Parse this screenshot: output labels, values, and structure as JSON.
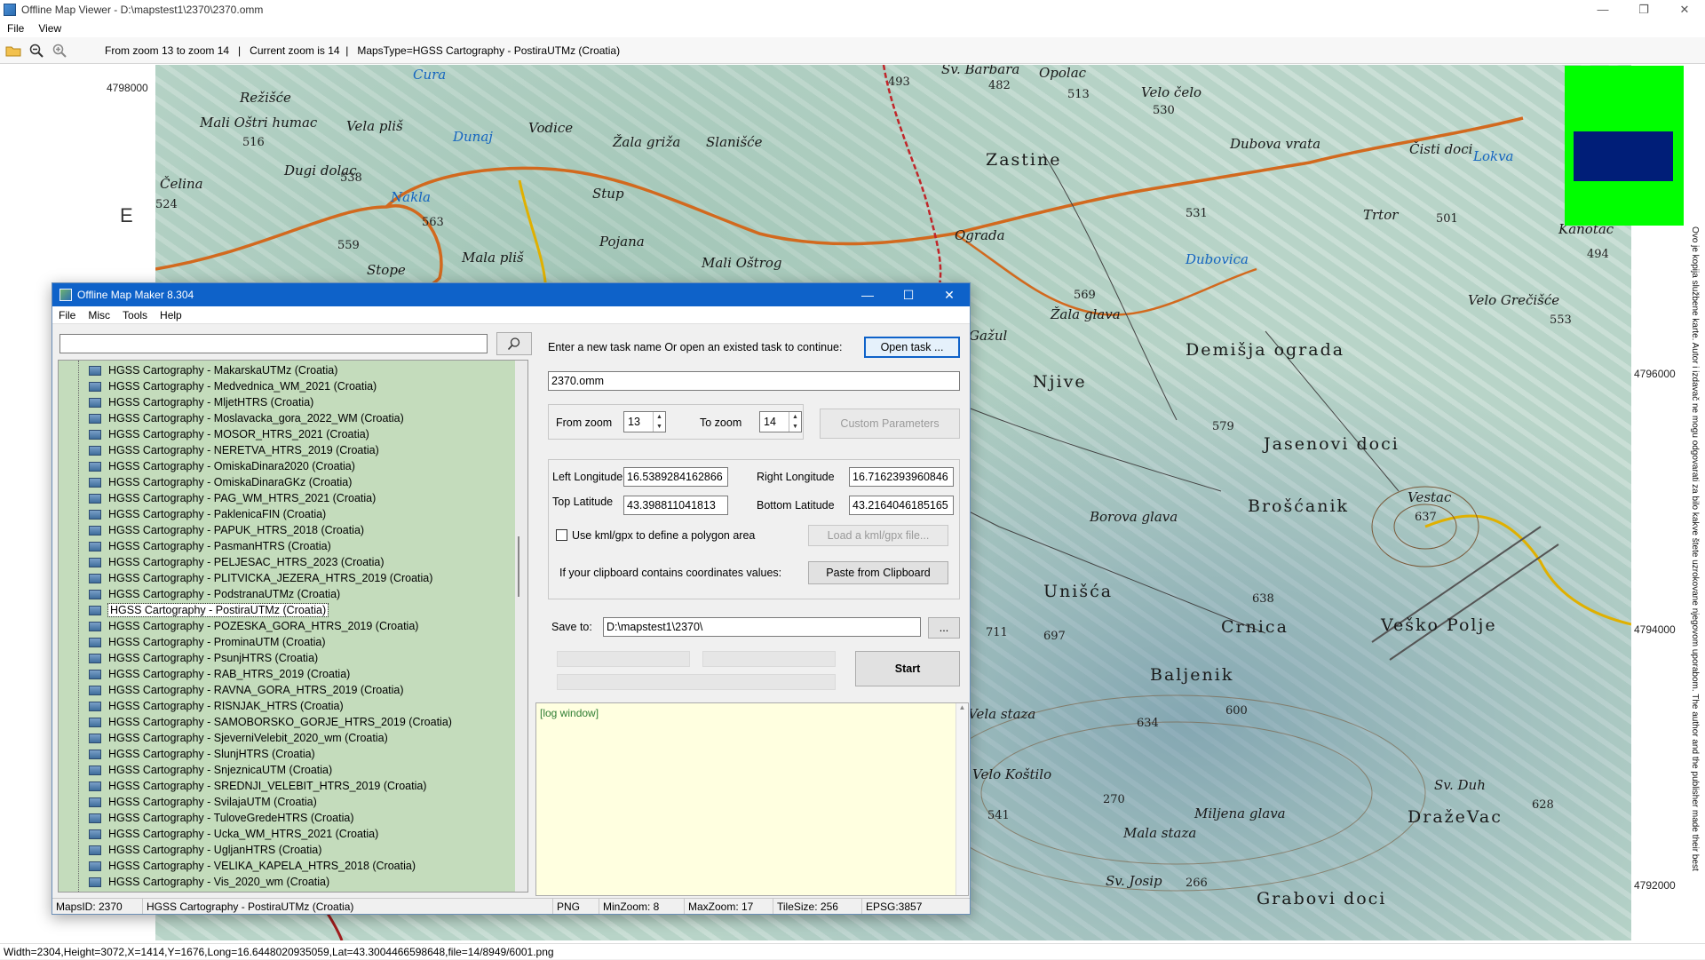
{
  "viewer": {
    "title": "Offline Map Viewer - D:\\mapstest1\\2370\\2370.omm",
    "menu": [
      "File",
      "View"
    ],
    "toolbar_status": "From zoom 13 to zoom 14   |   Current zoom is 14  |   MapsType=HGSS Cartography - PostiraUTMz (Croatia)",
    "status_bar": "Width=2304,Height=3072,X=1414,Y=1676,Long=16.6448020935059,Lat=43.3004466598648,file=14/8949/6001.png"
  },
  "map": {
    "coords_left": [
      "4798000"
    ],
    "coords_right": [
      "4796000",
      "4794000",
      "4792000"
    ],
    "edge_letter": "E",
    "labels": [
      "Režišće",
      "Mali Oštri humac",
      "Cura",
      "Dunaj",
      "Vodice",
      "Žala griža",
      "Slanišće",
      "Stup",
      "Pojana",
      "Mali Oštrog",
      "Nakla",
      "Čelina",
      "Ograda",
      "Zastine",
      "Opolac",
      "Velo čelo",
      "Dubova vrata",
      "Čisti doci",
      "Lokva",
      "Trtor",
      "Kanotac",
      "Dubovica",
      "Demišja ograda",
      "Velo Grečišće",
      "Žala glava",
      "Njive",
      "Jasenovi doci",
      "Brošćanik",
      "Vestac",
      "Borova glava",
      "Unišća",
      "Crnica",
      "Baljenik",
      "Veško Polje",
      "Mala staza",
      "Miljena glava",
      "Sv. Josip",
      "Sv. Duh",
      "DražeVac",
      "Grabovi doci",
      "Sv. Barbara",
      "Mala pliš",
      "Stope",
      "Gažul",
      "Vela pliš",
      "Dugi dolac",
      "Vela staza",
      "Velo Koštilo"
    ],
    "numbers": [
      "482",
      "513",
      "530",
      "493",
      "563",
      "538",
      "516",
      "524",
      "559",
      "531",
      "501",
      "494",
      "553",
      "569",
      "579",
      "637",
      "638",
      "697",
      "634",
      "600",
      "628",
      "270",
      "541",
      "266",
      "711"
    ],
    "vertical_note": "Ovo je kopija službene karte. Autor i izdavač ne mogu odgovarati za bilo kakve štete uzrokovane njegovom uporabom. The author and the publisher made their best"
  },
  "maker": {
    "title": "Offline Map Maker 8.304",
    "menu": [
      "File",
      "Misc",
      "Tools",
      "Help"
    ],
    "search_value": "",
    "maps_list": [
      "HGSS Cartography - MakarskaUTMz (Croatia)",
      "HGSS Cartography - Medvednica_WM_2021 (Croatia)",
      "HGSS Cartography - MljetHTRS (Croatia)",
      "HGSS Cartography - Moslavacka_gora_2022_WM (Croatia)",
      "HGSS Cartography - MOSOR_HTRS_2021 (Croatia)",
      "HGSS Cartography - NERETVA_HTRS_2019 (Croatia)",
      "HGSS Cartography - OmiskaDinara2020 (Croatia)",
      "HGSS Cartography - OmiskaDinaraGKz (Croatia)",
      "HGSS Cartography - PAG_WM_HTRS_2021 (Croatia)",
      "HGSS Cartography - PaklenicaFIN (Croatia)",
      "HGSS Cartography - PAPUK_HTRS_2018 (Croatia)",
      "HGSS Cartography - PasmanHTRS (Croatia)",
      "HGSS Cartography - PELJESAC_HTRS_2023 (Croatia)",
      "HGSS Cartography - PLITVICKA_JEZERA_HTRS_2019 (Croatia)",
      "HGSS Cartography - PodstranaUTMz (Croatia)",
      "HGSS Cartography - PostiraUTMz (Croatia)",
      "HGSS Cartography - POZESKA_GORA_HTRS_2019 (Croatia)",
      "HGSS Cartography - ProminaUTM (Croatia)",
      "HGSS Cartography - PsunjHTRS (Croatia)",
      "HGSS Cartography - RAB_HTRS_2019 (Croatia)",
      "HGSS Cartography - RAVNA_GORA_HTRS_2019 (Croatia)",
      "HGSS Cartography - RISNJAK_HTRS (Croatia)",
      "HGSS Cartography - SAMOBORSKO_GORJE_HTRS_2019 (Croatia)",
      "HGSS Cartography - SjeverniVelebit_2020_wm (Croatia)",
      "HGSS Cartography - SlunjHTRS (Croatia)",
      "HGSS Cartography - SnjeznicaUTM (Croatia)",
      "HGSS Cartography - SREDNJI_VELEBIT_HTRS_2019 (Croatia)",
      "HGSS Cartography - SvilajaUTM (Croatia)",
      "HGSS Cartography - TuloveGredeHTRS (Croatia)",
      "HGSS Cartography - Ucka_WM_HTRS_2021 (Croatia)",
      "HGSS Cartography - UgljanHTRS (Croatia)",
      "HGSS Cartography - VELIKA_KAPELA_HTRS_2018 (Croatia)",
      "HGSS Cartography - Vis_2020_wm (Croatia)"
    ],
    "selected_map": "HGSS Cartography - PostiraUTMz (Croatia)",
    "task_prompt": "Enter a new task name Or open an existed task to continue:",
    "open_task_label": "Open task ...",
    "task_name": "2370.omm",
    "from_zoom_label": "From zoom",
    "from_zoom": "13",
    "to_zoom_label": "To zoom",
    "to_zoom": "14",
    "custom_params_label": "Custom Parameters",
    "left_lon_label": "Left Longitude",
    "left_lon": "16.5389284162866",
    "right_lon_label": "Right Longitude",
    "right_lon": "16.7162393960846",
    "top_lat_label": "Top Latitude",
    "top_lat": "43.398811041813",
    "bottom_lat_label": "Bottom Latitude",
    "bottom_lat": "43.2164046185165",
    "kml_label": "Use kml/gpx to define a polygon area",
    "kml_checked": false,
    "load_kml_label": "Load a kml/gpx file...",
    "clipboard_label": "If your clipboard contains coordinates values:",
    "paste_label": "Paste from Clipboard",
    "save_to_label": "Save to:",
    "save_to": "D:\\mapstest1\\2370\\",
    "browse_label": "...",
    "start_label": "Start",
    "log_text": "[log window]",
    "status": {
      "maps_id": "MapsID: 2370",
      "map_name": "HGSS Cartography - PostiraUTMz (Croatia)",
      "format": "PNG",
      "min_zoom": "MinZoom: 8",
      "max_zoom": "MaxZoom: 17",
      "tile_size": "TileSize: 256",
      "epsg": "EPSG:3857"
    }
  },
  "colors": {
    "title_blue": "#0e62c9",
    "tree_bg": "#c4dcbc",
    "log_bg": "#ffffe0",
    "overview_green": "#00ff00",
    "overview_rect": "#001e78"
  }
}
